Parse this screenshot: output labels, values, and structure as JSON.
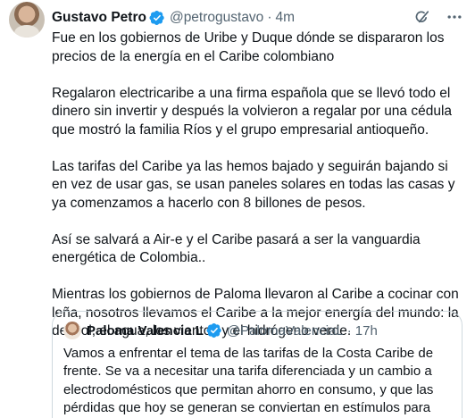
{
  "tweet": {
    "author_name": "Gustavo Petro",
    "handle": "@petrogustavo",
    "separator": "·",
    "time": "4m",
    "paragraphs": [
      "Fue en los gobiernos de Uribe y Duque dónde se dispararon los precios de la energía en el Caribe colombiano",
      "Regalaron electricaribe a una firma española que se llevó todo el dinero sin invertir y después la volvieron a regalar por una cédula que mostró la familia Ríos y el grupo empresarial antioqueño.",
      "Las tarifas del Caribe ya las hemos bajado y seguirán bajando si en vez de usar gas, se usan paneles solares en todas las casas y ya comenzamos a hacerlo con 8 billones de pesos.",
      "Así se salvará a Air-e y el Caribe pasará a ser la vanguardia energética de Colombia..",
      "Mientras los gobiernos de Paloma llevaron al Caribe a cocinar con leña, nosotros llevamos el Caribe a la mejor energía del mundo: la del sol, el agua, los vientos y el hidrógeno verde."
    ],
    "icons": {
      "verified": "verified-badge-icon",
      "grok": "grok-icon",
      "more": "more-options-icon"
    },
    "colors": {
      "verified": "#1d9bf0",
      "text": "#0f1419",
      "secondary": "#536471",
      "border": "#cfd9de"
    }
  },
  "quote": {
    "author_name": "Paloma Valencia L",
    "handle": "@PalomaValenciaL",
    "separator": "·",
    "time": "17h",
    "text": "Vamos a enfrentar el tema de las tarifas de la Costa Caribe de frente. Se va a necesitar una tarifa diferenciada y un cambio a electrodomésticos que permitan ahorro en consumo, y que las pérdidas que hoy se generan se conviertan en estímulos para que las empresas corrijan. Los"
  }
}
